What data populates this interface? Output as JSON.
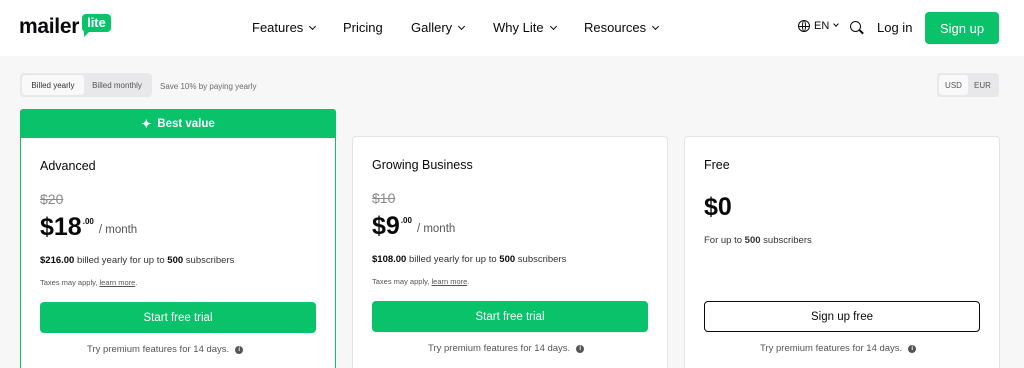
{
  "header": {
    "logo_text": "mailer",
    "logo_badge": "lite",
    "nav": [
      {
        "label": "Features",
        "has_dropdown": true
      },
      {
        "label": "Pricing",
        "has_dropdown": false
      },
      {
        "label": "Gallery",
        "has_dropdown": true
      },
      {
        "label": "Why Lite",
        "has_dropdown": true
      },
      {
        "label": "Resources",
        "has_dropdown": true
      }
    ],
    "language": "EN",
    "login": "Log in",
    "signup": "Sign up"
  },
  "billing": {
    "yearly": "Billed yearly",
    "monthly": "Billed monthly",
    "selected": "Billed yearly",
    "save_note": "Save 10% by paying yearly"
  },
  "currency": {
    "options": [
      "USD",
      "EUR"
    ],
    "selected": "USD"
  },
  "plans": [
    {
      "badge": "Best value",
      "name": "Advanced",
      "old_price": "$20",
      "price": "$18",
      "cents": ".00",
      "per": "/ month",
      "billed_amount": "$216.00",
      "billed_text": "billed yearly for up to",
      "subscribers": "500",
      "subscribers_suffix": "subscribers",
      "taxes": "Taxes may apply,",
      "learn_more": "learn more",
      "cta": "Start free trial",
      "note": "Try premium features for 14 days."
    },
    {
      "name": "Growing Business",
      "old_price": "$10",
      "price": "$9",
      "cents": ".00",
      "per": "/ month",
      "billed_amount": "$108.00",
      "billed_text": "billed yearly for up to",
      "subscribers": "500",
      "subscribers_suffix": "subscribers",
      "taxes": "Taxes may apply,",
      "learn_more": "learn more",
      "cta": "Start free trial",
      "note": "Try premium features for 14 days."
    },
    {
      "name": "Free",
      "price": "$0",
      "sub_prefix": "For up to",
      "subscribers": "500",
      "subscribers_suffix": "subscribers",
      "cta": "Sign up free",
      "note": "Try premium features for 14 days."
    }
  ],
  "colors": {
    "brand": "#09c269",
    "text": "#09090b",
    "background": "#f7f7f7"
  },
  "icons": [
    "chevron-down-icon",
    "globe-icon",
    "search-icon",
    "sparkle-icon",
    "info-icon"
  ]
}
